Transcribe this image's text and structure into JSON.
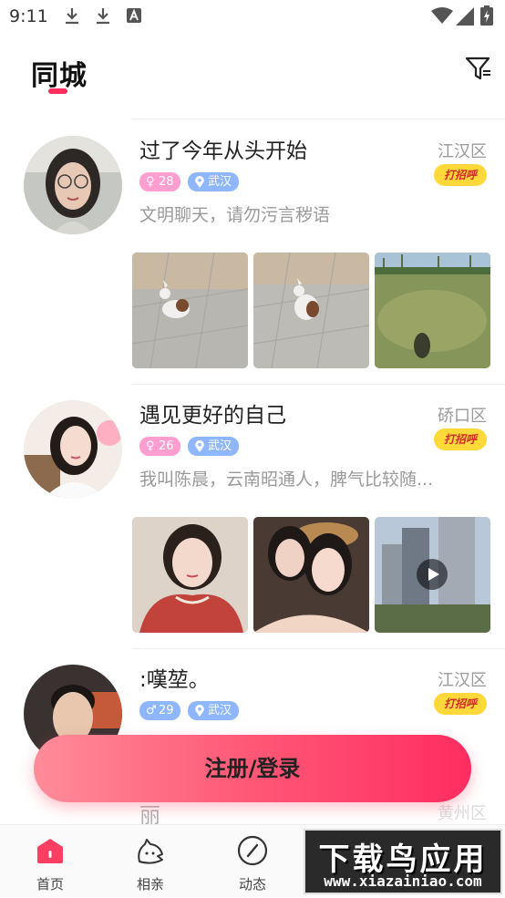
{
  "status_bar": {
    "time": "9:11"
  },
  "header": {
    "title": "同城"
  },
  "feed": [
    {
      "name": "过了今年从头开始",
      "district": "江汉区",
      "greet_label": "打招呼",
      "gender": "female",
      "age": "28",
      "city": "武汉",
      "bio": "文明聊天，请勿污言秽语",
      "photos": [
        "dog-on-pavement",
        "dog-on-pavement",
        "grass-lawn"
      ]
    },
    {
      "name": "遇见更好的自己",
      "district": "硚口区",
      "greet_label": "打招呼",
      "gender": "female",
      "age": "26",
      "city": "武汉",
      "bio": "我叫陈晨，云南昭通人，脾气比较随...",
      "photos": [
        "selfie-red-top",
        "selfie-duo",
        "city-buildings-video"
      ]
    },
    {
      "name": ":嘆堃。",
      "district": "江汉区",
      "greet_label": "打招呼",
      "gender": "male",
      "age": "29",
      "city": "武汉",
      "bio": "",
      "photos": []
    },
    {
      "name": "丽",
      "district": "黄州区",
      "greet_label": "",
      "gender": "",
      "age": "",
      "city": "",
      "bio": "",
      "photos": []
    }
  ],
  "cta": {
    "label": "注册/登录"
  },
  "tabbar": {
    "tabs": [
      {
        "label": "首页",
        "icon": "home-icon",
        "active": true
      },
      {
        "label": "相亲",
        "icon": "matchmaking-icon",
        "active": false
      },
      {
        "label": "动态",
        "icon": "feed-icon",
        "active": false
      }
    ]
  },
  "watermark": {
    "title": "下载鸟应用",
    "url": "www.xiazainiao.com"
  },
  "colors": {
    "accent": "#ff2e5c",
    "greet_bg": "#ffd83a",
    "female_tag": "#ff9ed0",
    "male_tag": "#8fb7ff"
  }
}
